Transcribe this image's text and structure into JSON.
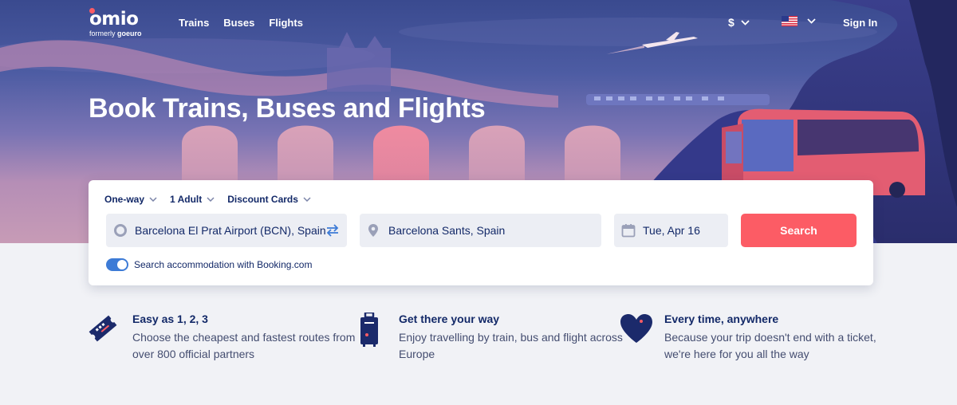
{
  "brand": {
    "name": "omio",
    "tagline_prefix": "formerly",
    "tagline_brand": "goeuro",
    "accent": "#fc5c65",
    "navy": "#132968"
  },
  "nav": {
    "items": [
      "Trains",
      "Buses",
      "Flights"
    ]
  },
  "header": {
    "currency": "$",
    "language_icon": "us-flag-icon",
    "sign_in": "Sign In"
  },
  "hero": {
    "headline": "Book Trains, Buses and Flights"
  },
  "search": {
    "trip_type": "One-way",
    "passengers": "1 Adult",
    "discount": "Discount Cards",
    "from_value": "Barcelona El Prat Airport (BCN), Spain",
    "to_value": "Barcelona Sants, Spain",
    "date_value": "Tue, Apr 16",
    "search_label": "Search",
    "accommodation_label": "Search accommodation with Booking.com",
    "accommodation_enabled": true
  },
  "features": [
    {
      "icon": "ticket-icon",
      "title": "Easy as 1, 2, 3",
      "text": "Choose the cheapest and fastest routes from over 800 official partners"
    },
    {
      "icon": "luggage-icon",
      "title": "Get there your way",
      "text": "Enjoy travelling by train, bus and flight across Europe"
    },
    {
      "icon": "heart-icon",
      "title": "Every time, anywhere",
      "text": "Because your trip doesn't end with a ticket, we're here for you all the way"
    }
  ]
}
